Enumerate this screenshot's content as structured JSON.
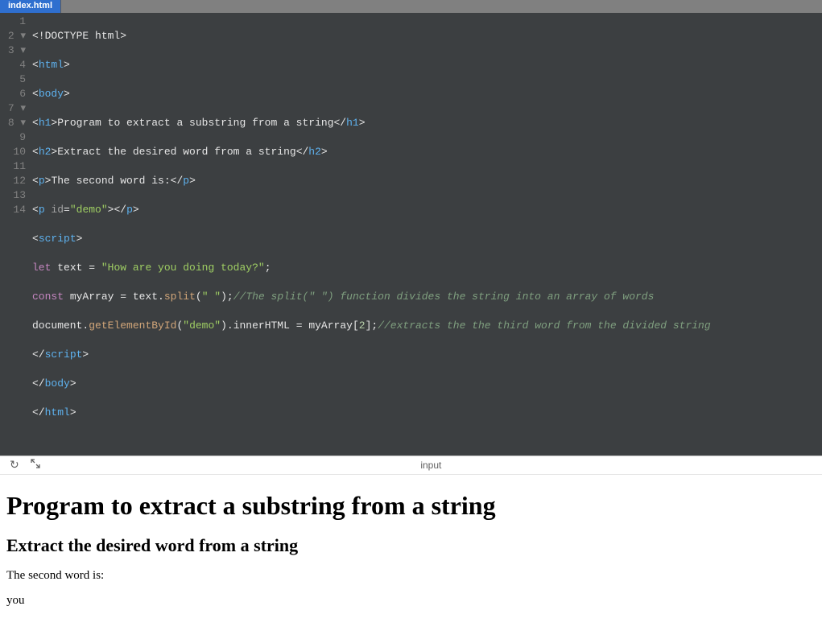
{
  "tab": {
    "filename": "index.html"
  },
  "gutter": {
    "lines": [
      "1",
      "2",
      "3",
      "4",
      "5",
      "6",
      "7",
      "8",
      "9",
      "10",
      "11",
      "12",
      "13",
      "14"
    ],
    "folds": [
      2,
      3,
      7,
      8
    ]
  },
  "code": {
    "l1": {
      "doctype": "<!DOCTYPE html>"
    },
    "l2": {
      "open": "<",
      "tag": "html",
      "close": ">"
    },
    "l3": {
      "open": "<",
      "tag": "body",
      "close": ">"
    },
    "l4": {
      "open": "<",
      "tag": "h1",
      "close": ">",
      "text": "Program to extract a substring from a string",
      "copen": "</",
      "ctag": "h1",
      "cclose": ">"
    },
    "l5": {
      "open": "<",
      "tag": "h2",
      "close": ">",
      "text": "Extract the desired word from a string",
      "copen": "</",
      "ctag": "h2",
      "cclose": ">"
    },
    "l6": {
      "open": "<",
      "tag": "p",
      "close": ">",
      "text": "The second word is:",
      "copen": "</",
      "ctag": "p",
      "cclose": ">"
    },
    "l7": {
      "open": "<",
      "tag": "p",
      "attr": " id",
      "eq": "=",
      "val": "\"demo\"",
      "close": ">",
      "copen": "</",
      "ctag": "p",
      "cclose": ">"
    },
    "l8": {
      "open": "<",
      "tag": "script",
      "close": ">"
    },
    "l9": {
      "kw": "let ",
      "id": "text",
      "op": " = ",
      "str": "\"How are you doing today?\"",
      "semi": ";"
    },
    "l10": {
      "kw": "const ",
      "id": "myArray",
      "op": " = ",
      "obj": "text",
      "dot": ".",
      "method": "split",
      "paren1": "(",
      "arg": "\" \"",
      "paren2": ")",
      "semi": ";",
      "comment": "//The split(\" \") function divides the string into an array of words"
    },
    "l11": {
      "obj": "document",
      "dot": ".",
      "method": "getElementById",
      "paren1": "(",
      "arg": "\"demo\"",
      "paren2": ")",
      "dot2": ".",
      "prop": "innerHTML",
      "op": " = ",
      "rhs1": "myArray",
      "br1": "[",
      "idx": "2",
      "br2": "]",
      "semi": ";",
      "comment": "//extracts the the third word from the divided string"
    },
    "l12": {
      "open": "</",
      "tag": "script",
      "close": ">"
    },
    "l13": {
      "open": "</",
      "tag": "body",
      "close": ">"
    },
    "l14": {
      "open": "</",
      "tag": "html",
      "close": ">"
    }
  },
  "divider": {
    "title": "input"
  },
  "output": {
    "h1": "Program to extract a substring from a string",
    "h2": "Extract the desired word from a string",
    "p1": "The second word is:",
    "p2": "you"
  }
}
